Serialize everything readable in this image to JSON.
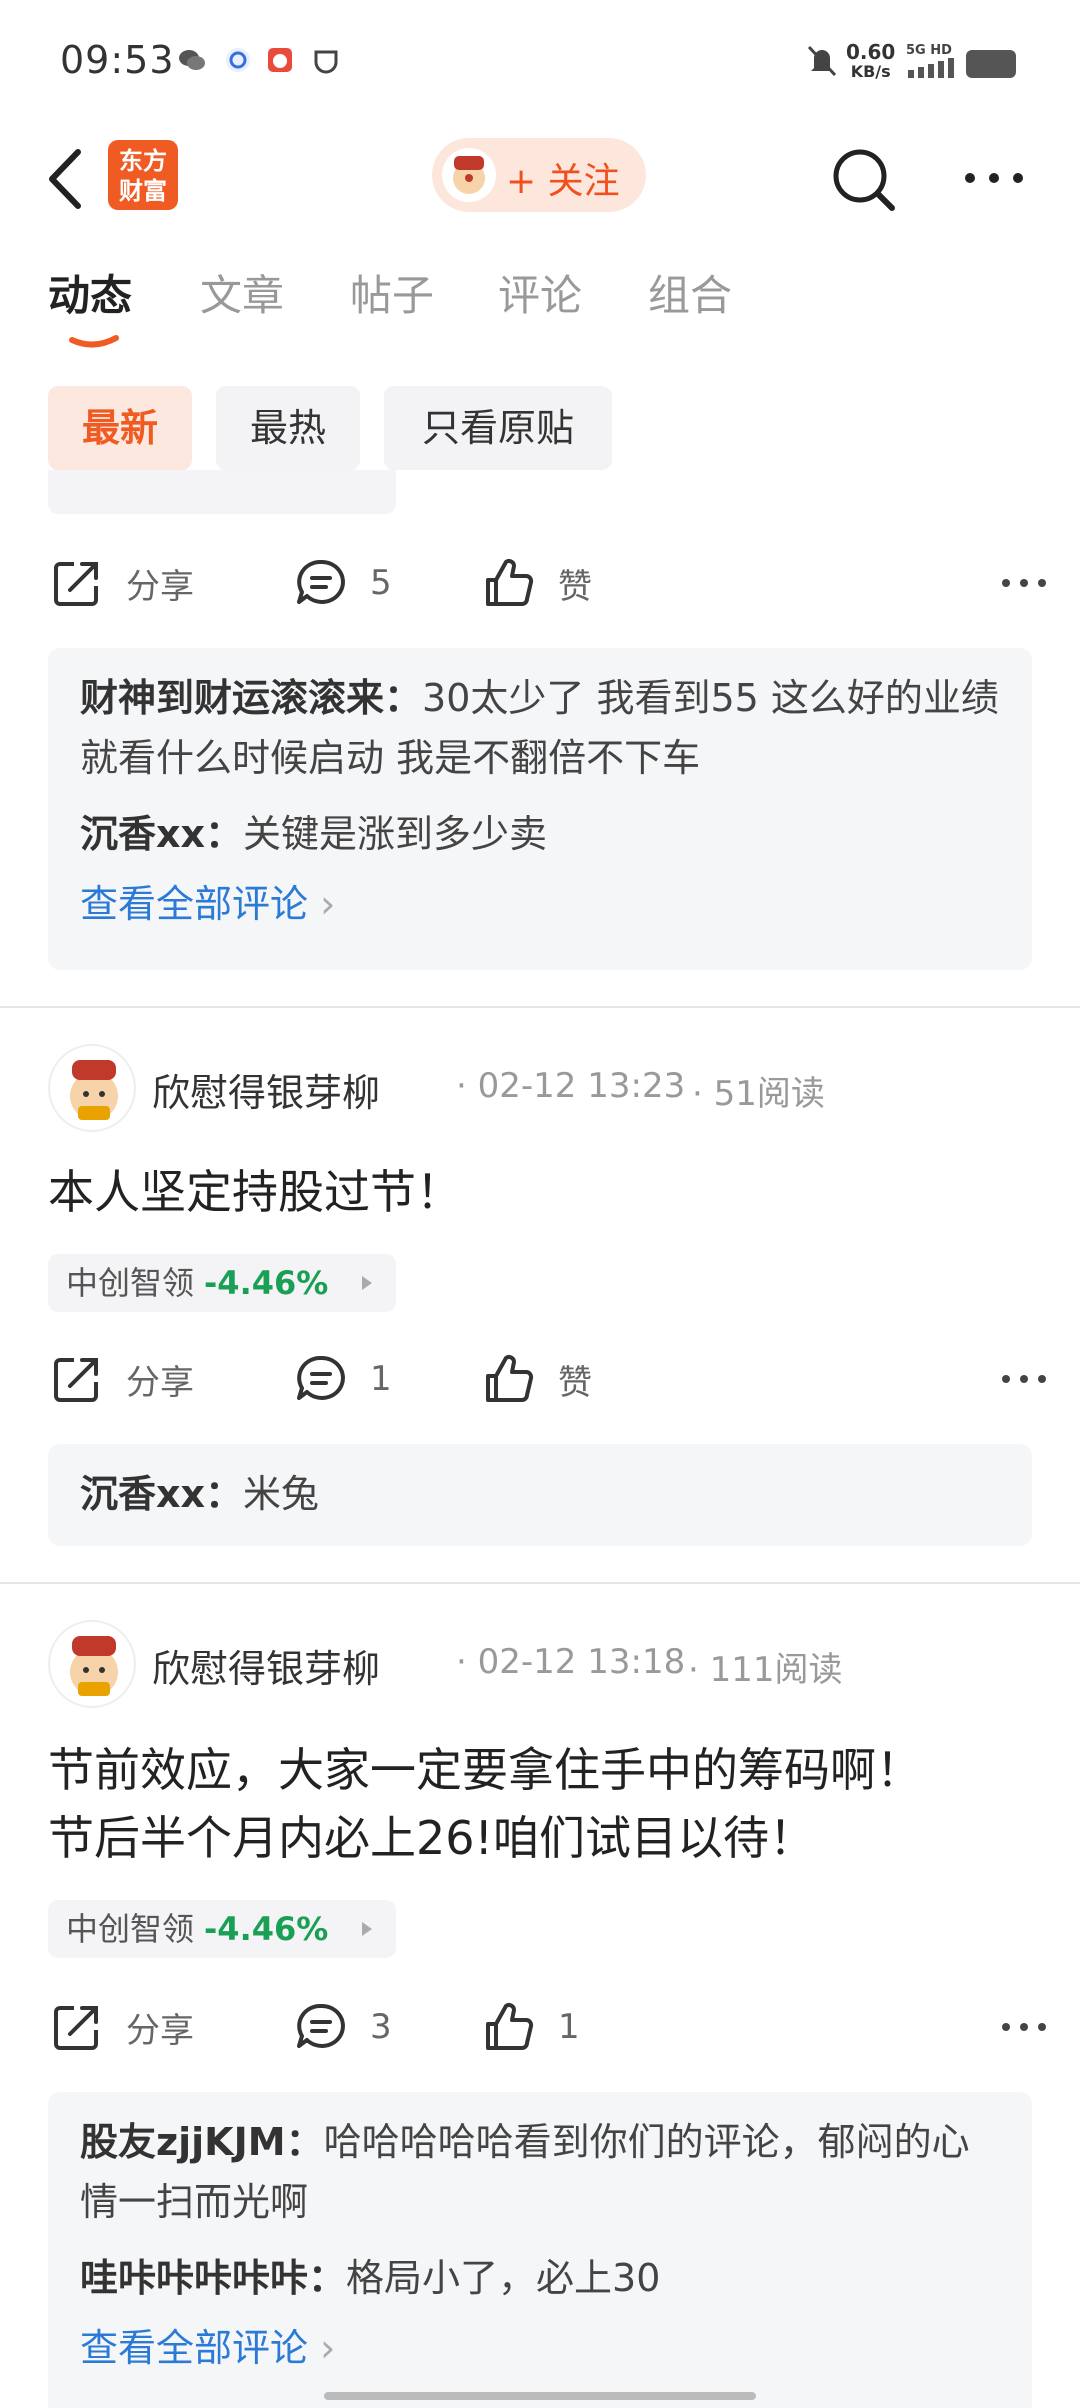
{
  "status_bar": {
    "time": "09:53",
    "net_speed": "0.60",
    "net_unit": "KB/s",
    "net_type": "5G HD"
  },
  "header": {
    "logo_line1": "东方",
    "logo_line2": "财富",
    "follow_label": "+ 关注"
  },
  "tabs": [
    "动态",
    "文章",
    "帖子",
    "评论",
    "组合"
  ],
  "filters": [
    "最新",
    "最热",
    "只看原贴"
  ],
  "post0": {
    "share": "分享",
    "comments": "5",
    "like": "赞",
    "comment_list": [
      {
        "user": "财神到财运滚滚来：",
        "text": "30太少了 我看到55 这么好的业绩 就看什么时候启动 我是不翻倍不下车"
      },
      {
        "user": "沉香xx：",
        "text": "关键是涨到多少卖"
      }
    ],
    "view_all": "查看全部评论"
  },
  "post1": {
    "author": "欣慰得银芽柳",
    "time": "· 02-12 13:23",
    "reads": "· 51阅读",
    "body": "本人坚定持股过节！",
    "stock_name": "中创智领",
    "stock_change": "-4.46%",
    "share": "分享",
    "comments": "1",
    "like": "赞",
    "comment_list": [
      {
        "user": "沉香xx：",
        "text": "米兔"
      }
    ]
  },
  "post2": {
    "author": "欣慰得银芽柳",
    "time": "· 02-12 13:18",
    "reads": "· 111阅读",
    "body_line1": "节前效应，大家一定要拿住手中的筹码啊！",
    "body_line2": "节后半个月内必上26!咱们试目以待！",
    "stock_name": "中创智领",
    "stock_change": "-4.46%",
    "share": "分享",
    "comments": "3",
    "like": "1",
    "comment_list": [
      {
        "user": "股友zjjKJM：",
        "text": "哈哈哈哈哈看到你们的评论，郁闷的心情一扫而光啊"
      },
      {
        "user": "哇咔咔咔咔咔：",
        "text": "格局小了，必上30"
      }
    ],
    "view_all": "查看全部评论"
  },
  "colors": {
    "brand": "#f05a23",
    "link": "#2b7bd6",
    "down": "#1aa055"
  }
}
